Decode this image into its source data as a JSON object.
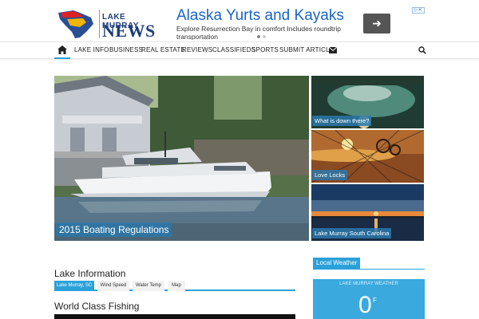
{
  "logo": {
    "line1": "LAKE MURRAY",
    "line2": "NEWS"
  },
  "ad": {
    "title": "Alaska Yurts and Kayaks",
    "description": "Explore Resurrection Bay in comfort Includes roundtrip transportation",
    "arrow": "➜",
    "adchoices": "▷✕"
  },
  "nav": {
    "items": [
      "LAKE INFO",
      "BUSINESS",
      "REAL ESTATE",
      "REVIEWS",
      "CLASSIFIEDS",
      "SPORTS",
      "SUBMIT ARTICLE"
    ]
  },
  "featured": {
    "main": {
      "caption": "2015 Boating Regulations"
    },
    "thumbs": [
      {
        "caption": "What is down there?"
      },
      {
        "caption": "Love Locks"
      },
      {
        "caption": "Lake Murray South Carolina"
      }
    ]
  },
  "lake_info": {
    "title": "Lake Information",
    "tabs": [
      "Lake Murray, SC",
      "Wind Speed",
      "Water Temp",
      "Map"
    ],
    "active_tab": 0
  },
  "fishing": {
    "title": "World Class Fishing"
  },
  "weather": {
    "section_title": "Local Weather",
    "widget_title": "LAKE MURRAY WEATHER",
    "temp": "0",
    "unit": "F"
  },
  "colors": {
    "accent": "#2ba1d9",
    "brand": "#1d3d7a",
    "ad_link": "#1a64c8"
  }
}
